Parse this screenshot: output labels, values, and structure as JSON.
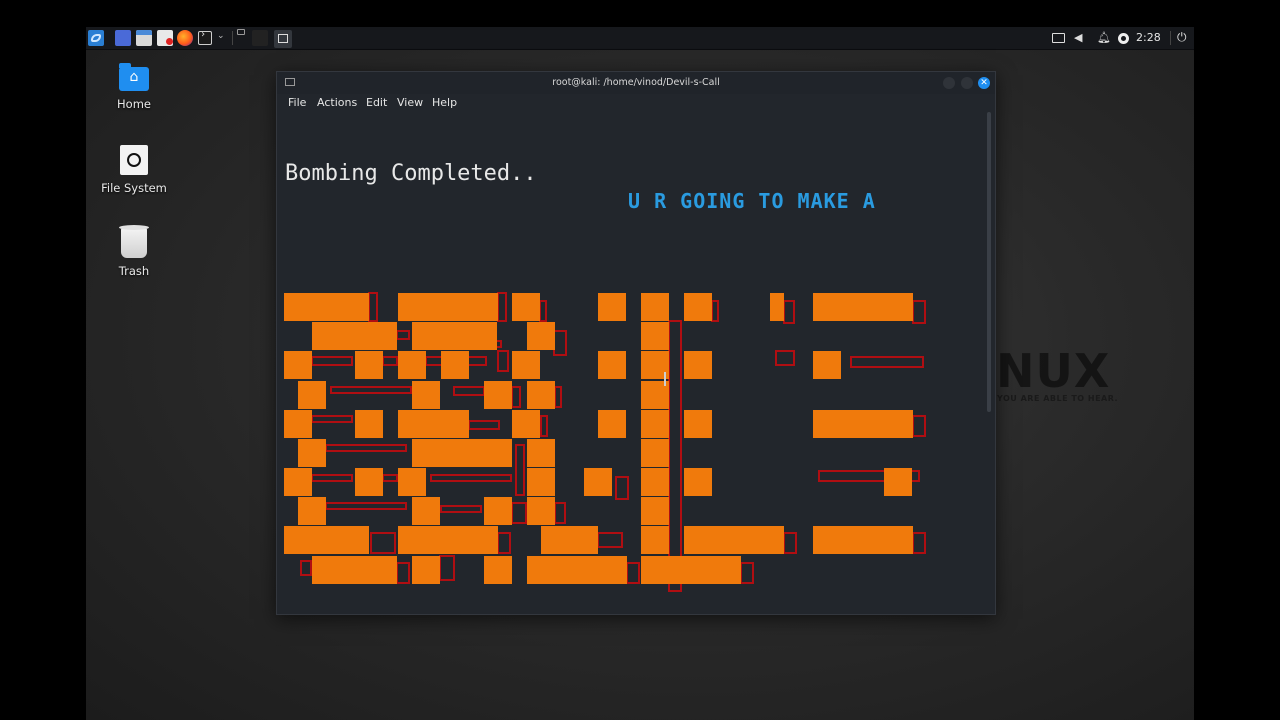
{
  "taskbar": {
    "clock": "2:28"
  },
  "desktop": {
    "icons": [
      {
        "label": "Home"
      },
      {
        "label": "File System"
      },
      {
        "label": "Trash"
      }
    ],
    "watermark": "NUX",
    "watermark_sub": "YOU ARE ABLE TO HEAR."
  },
  "terminal": {
    "title": "root@kali: /home/vinod/Devil-s-Call",
    "menu": [
      "File",
      "Actions",
      "Edit",
      "View",
      "Help"
    ],
    "output_line": "Bombing Completed..",
    "banner_line": "U R GOING TO MAKE A",
    "art_color": "#f07a0c",
    "art_shadow_color": "#b00e12"
  },
  "colors": {
    "accent": "#1f8ef0",
    "banner": "#2a9be0"
  }
}
